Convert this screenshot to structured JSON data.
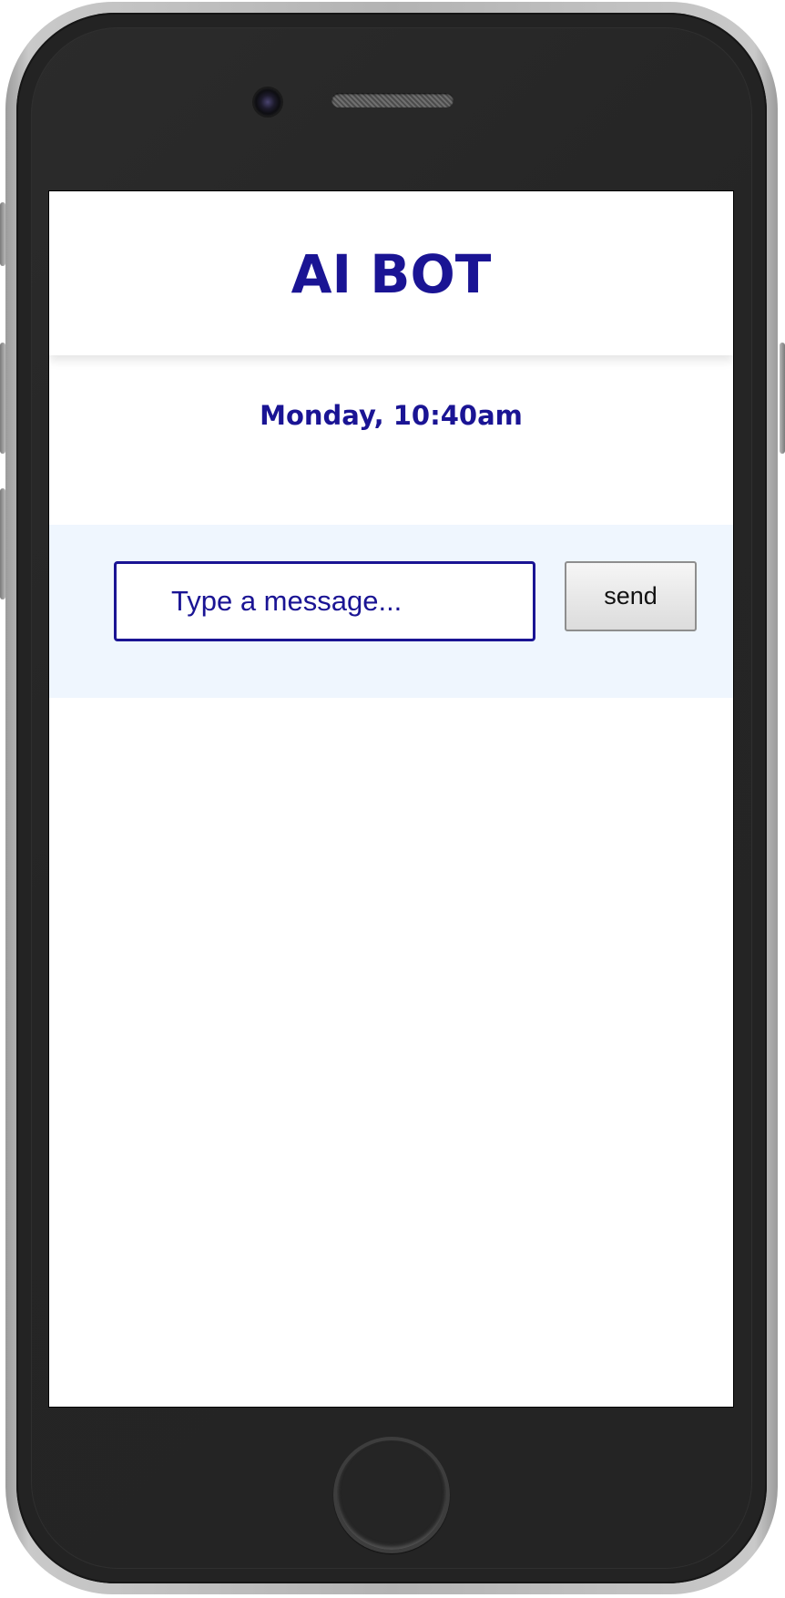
{
  "app": {
    "title": "AI BOT"
  },
  "chat": {
    "date_label": "Monday, 10:40am"
  },
  "composer": {
    "input_value": "",
    "input_placeholder": "Type a message...",
    "send_label": "send"
  },
  "colors": {
    "accent": "#1a1494",
    "composer_background": "#eff6fe",
    "phone_body": "#232323",
    "phone_frame": "#b3b3b3"
  },
  "icons": {
    "camera": "front-camera-icon",
    "speaker": "earpiece-speaker-icon",
    "home": "home-button-icon"
  }
}
